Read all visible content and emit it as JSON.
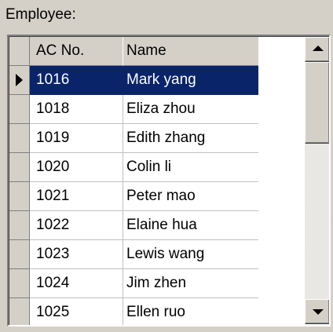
{
  "group": {
    "label": "Employee:"
  },
  "grid": {
    "columns": [
      "AC No.",
      "Name"
    ],
    "selected_index": 0,
    "rows": [
      {
        "ac": "1016",
        "name": "Mark yang"
      },
      {
        "ac": "1018",
        "name": "Eliza zhou"
      },
      {
        "ac": "1019",
        "name": "Edith zhang"
      },
      {
        "ac": "1020",
        "name": "Colin li"
      },
      {
        "ac": "1021",
        "name": "Peter mao"
      },
      {
        "ac": "1022",
        "name": "Elaine hua"
      },
      {
        "ac": "1023",
        "name": "Lewis wang"
      },
      {
        "ac": "1024",
        "name": "Jim zhen"
      },
      {
        "ac": "1025",
        "name": "Ellen ruo"
      }
    ]
  },
  "colors": {
    "selection": "#0a246a",
    "face": "#d4d0c8"
  },
  "icons": {
    "row_pointer": "triangle-right-icon",
    "scroll_up": "arrow-up-icon",
    "scroll_down": "arrow-down-icon"
  }
}
